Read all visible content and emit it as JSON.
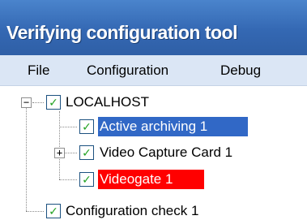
{
  "window": {
    "title": "Verifying configuration tool"
  },
  "menu": {
    "file": "File",
    "configuration": "Configuration",
    "debug": "Debug"
  },
  "tree": {
    "root": {
      "label": "LOCALHOST",
      "expander": "−",
      "checked": true
    },
    "children": [
      {
        "label": "Active archiving 1",
        "checked": true,
        "highlight": "#3168c6"
      },
      {
        "label": "Video Capture Card 1",
        "checked": true,
        "expander": "+"
      },
      {
        "label": "Videogate 1",
        "checked": true,
        "highlight": "#ff0000"
      }
    ],
    "sibling": {
      "label": "Configuration check 1",
      "checked": true
    },
    "check_glyph": "✓"
  },
  "colors": {
    "titlebar": "#3b71bb",
    "menubar": "#dbe6f5",
    "checkmark": "#21a121"
  }
}
